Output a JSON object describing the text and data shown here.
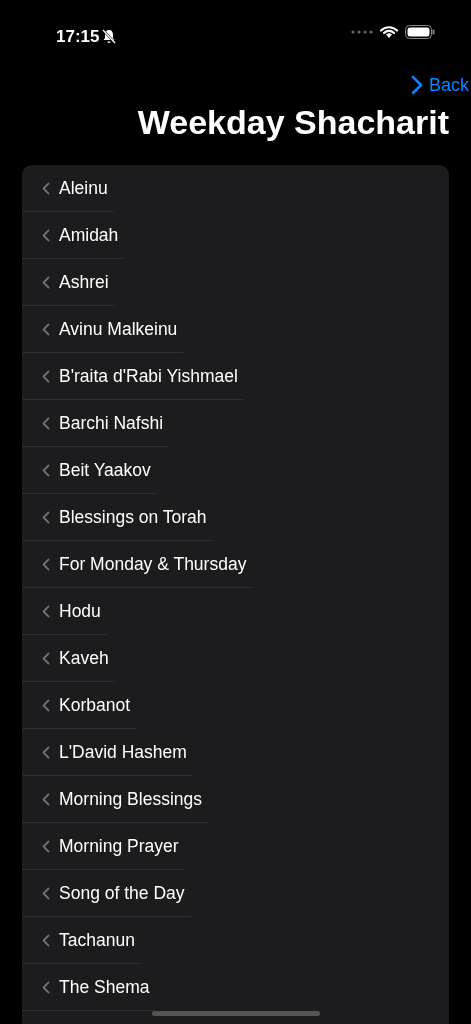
{
  "status_bar": {
    "time": "17:15"
  },
  "nav": {
    "back": "Back",
    "title": "Weekday Shacharit"
  },
  "items": [
    {
      "label": "Aleinu"
    },
    {
      "label": "Amidah"
    },
    {
      "label": "Ashrei"
    },
    {
      "label": "Avinu Malkeinu"
    },
    {
      "label": "B'raita d'Rabi Yishmael"
    },
    {
      "label": "Barchi Nafshi"
    },
    {
      "label": "Beit Yaakov"
    },
    {
      "label": "Blessings on Torah"
    },
    {
      "label": "For Monday & Thursday"
    },
    {
      "label": "Hodu"
    },
    {
      "label": "Kaveh"
    },
    {
      "label": "Korbanot"
    },
    {
      "label": "L'David Hashem"
    },
    {
      "label": "Morning Blessings"
    },
    {
      "label": "Morning Prayer"
    },
    {
      "label": "Song of the Day"
    },
    {
      "label": "Tachanun"
    },
    {
      "label": "The Shema"
    }
  ]
}
